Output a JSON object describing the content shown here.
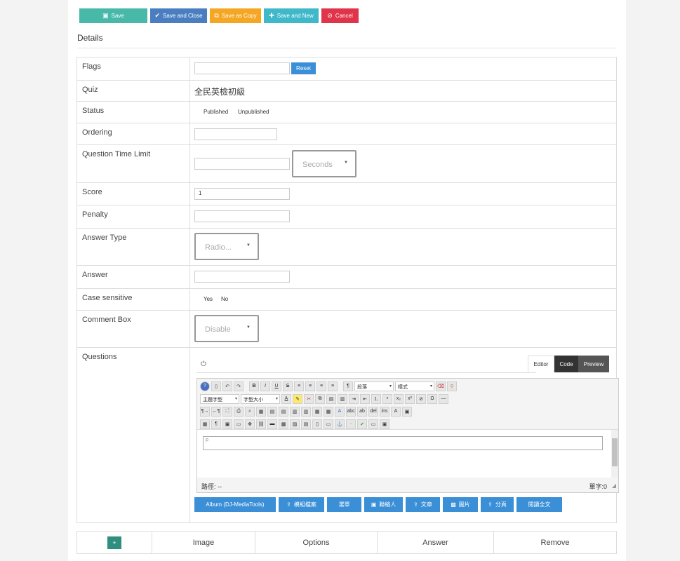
{
  "toolbar": {
    "save": "Save",
    "save_close": "Save and Close",
    "save_copy": "Save as Copy",
    "save_new": "Save and New",
    "cancel": "Cancel"
  },
  "details_title": "Details",
  "fields": {
    "flags": {
      "label": "Flags",
      "reset": "Reset"
    },
    "quiz": {
      "label": "Quiz",
      "value": "全民英檢初級"
    },
    "status": {
      "label": "Status",
      "options": [
        "Published",
        "Unpublished"
      ]
    },
    "ordering": {
      "label": "Ordering"
    },
    "time_limit": {
      "label": "Question Time Limit",
      "unit": "Seconds"
    },
    "score": {
      "label": "Score",
      "value": "1"
    },
    "penalty": {
      "label": "Penalty"
    },
    "answer_type": {
      "label": "Answer Type",
      "value": "Radio..."
    },
    "answer": {
      "label": "Answer"
    },
    "case_sensitive": {
      "label": "Case sensitive",
      "options": [
        "Yes",
        "No"
      ]
    },
    "comment_box": {
      "label": "Comment Box",
      "value": "Disable"
    },
    "questions": {
      "label": "Questions"
    }
  },
  "editor": {
    "tabs": [
      "Editor",
      "Code",
      "Preview"
    ],
    "format_select": "段落",
    "style_select": "樣式",
    "font_select": "主題字型",
    "size_select": "字型大小",
    "paragraph_marker": "p",
    "path_label": "路徑: --",
    "word_count": "單字:0",
    "buttons": [
      "Album (DJ-MediaTools)",
      "模組檔案",
      "選單",
      "聯絡人",
      "文章",
      "圖片",
      "分頁",
      "閱讀全文"
    ]
  },
  "bottom_table": {
    "add_label": "+",
    "headers": [
      "Image",
      "Options",
      "Answer",
      "Remove"
    ]
  },
  "colors": {
    "save": "#48b8a9",
    "save_close": "#4a7ec0",
    "save_copy": "#f5a623",
    "save_new": "#3fb8c9",
    "cancel": "#e0344a",
    "accent": "#3a8fd6",
    "add": "#2f8f7f"
  }
}
